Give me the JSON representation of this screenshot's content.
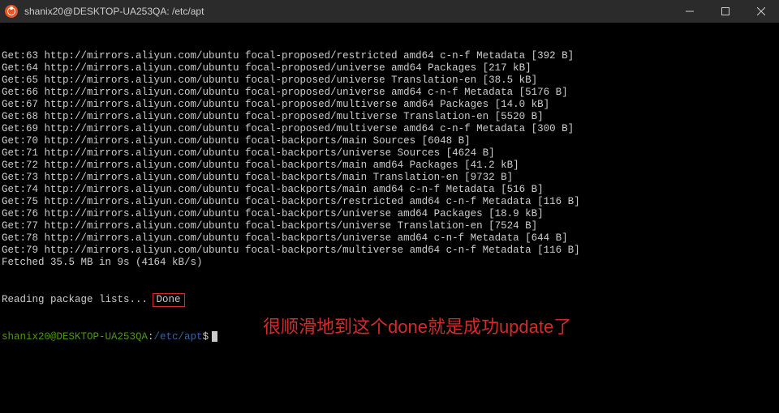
{
  "window": {
    "title": "shanix20@DESKTOP-UA253QA: /etc/apt"
  },
  "lines": [
    "Get:63 http://mirrors.aliyun.com/ubuntu focal-proposed/restricted amd64 c-n-f Metadata [392 B]",
    "Get:64 http://mirrors.aliyun.com/ubuntu focal-proposed/universe amd64 Packages [217 kB]",
    "Get:65 http://mirrors.aliyun.com/ubuntu focal-proposed/universe Translation-en [38.5 kB]",
    "Get:66 http://mirrors.aliyun.com/ubuntu focal-proposed/universe amd64 c-n-f Metadata [5176 B]",
    "Get:67 http://mirrors.aliyun.com/ubuntu focal-proposed/multiverse amd64 Packages [14.0 kB]",
    "Get:68 http://mirrors.aliyun.com/ubuntu focal-proposed/multiverse Translation-en [5520 B]",
    "Get:69 http://mirrors.aliyun.com/ubuntu focal-proposed/multiverse amd64 c-n-f Metadata [300 B]",
    "Get:70 http://mirrors.aliyun.com/ubuntu focal-backports/main Sources [6048 B]",
    "Get:71 http://mirrors.aliyun.com/ubuntu focal-backports/universe Sources [4624 B]",
    "Get:72 http://mirrors.aliyun.com/ubuntu focal-backports/main amd64 Packages [41.2 kB]",
    "Get:73 http://mirrors.aliyun.com/ubuntu focal-backports/main Translation-en [9732 B]",
    "Get:74 http://mirrors.aliyun.com/ubuntu focal-backports/main amd64 c-n-f Metadata [516 B]",
    "Get:75 http://mirrors.aliyun.com/ubuntu focal-backports/restricted amd64 c-n-f Metadata [116 B]",
    "Get:76 http://mirrors.aliyun.com/ubuntu focal-backports/universe amd64 Packages [18.9 kB]",
    "Get:77 http://mirrors.aliyun.com/ubuntu focal-backports/universe Translation-en [7524 B]",
    "Get:78 http://mirrors.aliyun.com/ubuntu focal-backports/universe amd64 c-n-f Metadata [644 B]",
    "Get:79 http://mirrors.aliyun.com/ubuntu focal-backports/multiverse amd64 c-n-f Metadata [116 B]",
    "Fetched 35.5 MB in 9s (4164 kB/s)"
  ],
  "reading_prefix": "Reading package lists... ",
  "done_text": "Done",
  "prompt": {
    "user_host": "shanix20@DESKTOP-UA253QA",
    "colon": ":",
    "path": "/etc/apt",
    "dollar": "$"
  },
  "annotation": "很顺滑地到这个done就是成功update了"
}
